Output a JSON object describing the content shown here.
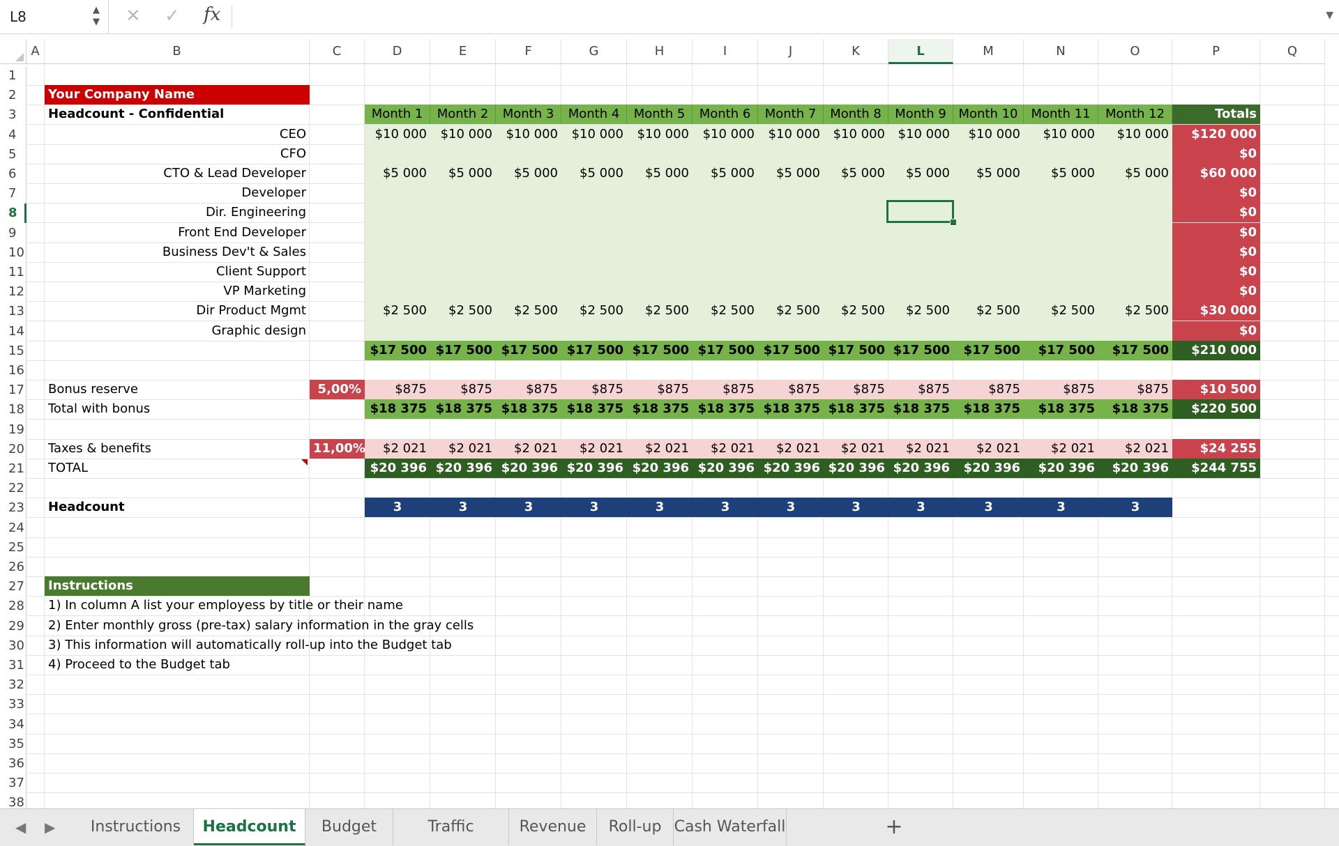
{
  "formula_bar": {
    "name_box": "L8",
    "fx_label": "fx",
    "content": ""
  },
  "columns": [
    "A",
    "B",
    "C",
    "D",
    "E",
    "F",
    "G",
    "H",
    "I",
    "J",
    "K",
    "L",
    "M",
    "N",
    "O",
    "P",
    "Q"
  ],
  "selected_column": "L",
  "rows": [
    1,
    2,
    3,
    4,
    5,
    6,
    7,
    8,
    9,
    10,
    11,
    12,
    13,
    14,
    15,
    16,
    17,
    18,
    19,
    20,
    21,
    22,
    23,
    24,
    25,
    26,
    27,
    28,
    29,
    30,
    31,
    32,
    33,
    34,
    35,
    36,
    37,
    38
  ],
  "selected_row": 8,
  "sheet": {
    "company_name": "Your Company Name",
    "subtitle": "Headcount - Confidential",
    "months": [
      "Month 1",
      "Month 2",
      "Month 3",
      "Month 4",
      "Month 5",
      "Month 6",
      "Month 7",
      "Month 8",
      "Month 9",
      "Month 10",
      "Month 11",
      "Month 12"
    ],
    "totals_header": "Totals",
    "roles": [
      {
        "title": "CEO",
        "values": [
          "$10 000",
          "$10 000",
          "$10 000",
          "$10 000",
          "$10 000",
          "$10 000",
          "$10 000",
          "$10 000",
          "$10 000",
          "$10 000",
          "$10 000",
          "$10 000"
        ],
        "total": "$120 000"
      },
      {
        "title": "CFO",
        "values": [
          "",
          "",
          "",
          "",
          "",
          "",
          "",
          "",
          "",
          "",
          "",
          ""
        ],
        "total": "$0"
      },
      {
        "title": "CTO & Lead Developer",
        "values": [
          "$5 000",
          "$5 000",
          "$5 000",
          "$5 000",
          "$5 000",
          "$5 000",
          "$5 000",
          "$5 000",
          "$5 000",
          "$5 000",
          "$5 000",
          "$5 000"
        ],
        "total": "$60 000"
      },
      {
        "title": "Developer",
        "values": [
          "",
          "",
          "",
          "",
          "",
          "",
          "",
          "",
          "",
          "",
          "",
          ""
        ],
        "total": "$0"
      },
      {
        "title": "Dir. Engineering",
        "values": [
          "",
          "",
          "",
          "",
          "",
          "",
          "",
          "",
          "",
          "",
          "",
          ""
        ],
        "total": "$0"
      },
      {
        "title": "Front End Developer",
        "values": [
          "",
          "",
          "",
          "",
          "",
          "",
          "",
          "",
          "",
          "",
          "",
          ""
        ],
        "total": "$0"
      },
      {
        "title": "Business Dev't & Sales",
        "values": [
          "",
          "",
          "",
          "",
          "",
          "",
          "",
          "",
          "",
          "",
          "",
          ""
        ],
        "total": "$0"
      },
      {
        "title": "Client Support",
        "values": [
          "",
          "",
          "",
          "",
          "",
          "",
          "",
          "",
          "",
          "",
          "",
          ""
        ],
        "total": "$0"
      },
      {
        "title": "VP Marketing",
        "values": [
          "",
          "",
          "",
          "",
          "",
          "",
          "",
          "",
          "",
          "",
          "",
          ""
        ],
        "total": "$0"
      },
      {
        "title": "Dir Product Mgmt",
        "values": [
          "$2 500",
          "$2 500",
          "$2 500",
          "$2 500",
          "$2 500",
          "$2 500",
          "$2 500",
          "$2 500",
          "$2 500",
          "$2 500",
          "$2 500",
          "$2 500"
        ],
        "total": "$30 000"
      },
      {
        "title": "Graphic design",
        "values": [
          "",
          "",
          "",
          "",
          "",
          "",
          "",
          "",
          "",
          "",
          "",
          ""
        ],
        "total": "$0"
      }
    ],
    "subtotal": {
      "values": [
        "$17 500",
        "$17 500",
        "$17 500",
        "$17 500",
        "$17 500",
        "$17 500",
        "$17 500",
        "$17 500",
        "$17 500",
        "$17 500",
        "$17 500",
        "$17 500"
      ],
      "total": "$210 000"
    },
    "bonus": {
      "label": "Bonus reserve",
      "rate": "5,00%",
      "values": [
        "$875",
        "$875",
        "$875",
        "$875",
        "$875",
        "$875",
        "$875",
        "$875",
        "$875",
        "$875",
        "$875",
        "$875"
      ],
      "total": "$10 500"
    },
    "total_with_bonus": {
      "label": "Total with bonus",
      "values": [
        "$18 375",
        "$18 375",
        "$18 375",
        "$18 375",
        "$18 375",
        "$18 375",
        "$18 375",
        "$18 375",
        "$18 375",
        "$18 375",
        "$18 375",
        "$18 375"
      ],
      "total": "$220 500"
    },
    "taxes": {
      "label": "Taxes & benefits",
      "rate": "11,00%",
      "values": [
        "$2 021",
        "$2 021",
        "$2 021",
        "$2 021",
        "$2 021",
        "$2 021",
        "$2 021",
        "$2 021",
        "$2 021",
        "$2 021",
        "$2 021",
        "$2 021"
      ],
      "total": "$24 255"
    },
    "grand_total": {
      "label": "TOTAL",
      "values": [
        "$20 396",
        "$20 396",
        "$20 396",
        "$20 396",
        "$20 396",
        "$20 396",
        "$20 396",
        "$20 396",
        "$20 396",
        "$20 396",
        "$20 396",
        "$20 396"
      ],
      "total": "$244 755"
    },
    "headcount": {
      "label": "Headcount",
      "values": [
        "3",
        "3",
        "3",
        "3",
        "3",
        "3",
        "3",
        "3",
        "3",
        "3",
        "3",
        "3"
      ]
    },
    "instructions": {
      "header": "Instructions",
      "lines": [
        "1) In column A list your employess by title or their name",
        "2) Enter monthly gross (pre-tax) salary information in the gray cells",
        "3) This information will automatically roll-up into the Budget tab",
        "4) Proceed to the Budget tab"
      ]
    }
  },
  "colors": {
    "accent": "#1e7145",
    "red_header": "#cc0000",
    "green_header": "#76b34a",
    "dark_green": "#2f5e22",
    "light_green_fill": "#e4f0d9",
    "rose": "#c9434c",
    "pink": "#f6d4d4",
    "navy": "#1d3f7a"
  },
  "tabs": [
    {
      "label": "Instructions",
      "active": false
    },
    {
      "label": "Headcount",
      "active": true
    },
    {
      "label": "Budget",
      "active": false
    },
    {
      "label": "Traffic Forecast",
      "active": false
    },
    {
      "label": "Revenue",
      "active": false
    },
    {
      "label": "Roll-up",
      "active": false
    },
    {
      "label": "Cash Waterfall",
      "active": false
    }
  ],
  "add_sheet_label": "+",
  "icons": {
    "cancel": "close-icon",
    "confirm": "check-icon",
    "prev": "triangle-left-icon",
    "next": "triangle-right-icon"
  }
}
